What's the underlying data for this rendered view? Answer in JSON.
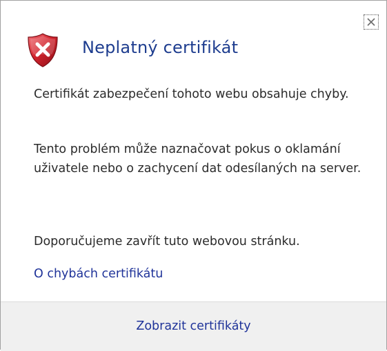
{
  "dialog": {
    "title": "Neplatný certifikát",
    "message_1": "Certifikát zabezpečení tohoto webu obsahuje chyby.",
    "message_2": "Tento problém může naznačovat pokus o oklamání uživatele nebo o zachycení dat odesílaných na server.",
    "recommendation": "Doporučujeme zavřít tuto webovou stránku.",
    "link_label": "O chybách certifikátu",
    "footer_button_label": "Zobrazit certifikáty",
    "icons": {
      "close": "close-icon",
      "status": "error-shield-icon"
    },
    "colors": {
      "title": "#1e3d8f",
      "link": "#1f3399",
      "shield_red": "#c8202a",
      "footer_bg": "#f0f0f0"
    }
  }
}
